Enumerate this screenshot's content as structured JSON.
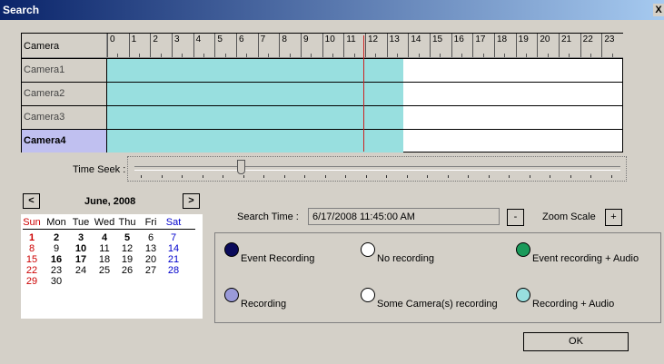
{
  "window": {
    "title": "Search",
    "close": "X"
  },
  "grid": {
    "header": "Camera",
    "hours": [
      "0",
      "1",
      "2",
      "3",
      "4",
      "5",
      "6",
      "7",
      "8",
      "9",
      "10",
      "11",
      "12",
      "13",
      "14",
      "15",
      "16",
      "17",
      "18",
      "19",
      "20",
      "21",
      "22",
      "23"
    ],
    "rows": [
      {
        "name": "Camera1",
        "selected": false
      },
      {
        "name": "Camera2",
        "selected": false
      },
      {
        "name": "Camera3",
        "selected": false
      },
      {
        "name": "Camera4",
        "selected": true
      }
    ],
    "recording_color": "#98dfdf",
    "cursor_color": "#cc2222"
  },
  "seek": {
    "label": "Time Seek :"
  },
  "calendar": {
    "prev": "<",
    "next": ">",
    "month": "June, 2008",
    "weekdays": [
      "Sun",
      "Mon",
      "Tue",
      "Wed",
      "Thu",
      "Fri",
      "Sat"
    ],
    "weeks": [
      [
        "1",
        "2",
        "3",
        "4",
        "5",
        "6",
        "7"
      ],
      [
        "8",
        "9",
        "10",
        "11",
        "12",
        "13",
        "14"
      ],
      [
        "15",
        "16",
        "17",
        "18",
        "19",
        "20",
        "21"
      ],
      [
        "22",
        "23",
        "24",
        "25",
        "26",
        "27",
        "28"
      ],
      [
        "29",
        "30",
        "",
        "",
        "",
        "",
        ""
      ]
    ]
  },
  "search_time": {
    "label": "Search Time :",
    "value": "6/17/2008 11:45:00 AM"
  },
  "zoom": {
    "label": "Zoom Scale",
    "minus": "-",
    "plus": "+"
  },
  "legend": [
    {
      "label": "Event Recording",
      "color": "#0a0a5a"
    },
    {
      "label": "No recording",
      "color": "#ffffff"
    },
    {
      "label": "Event recording + Audio",
      "color": "#1a9a5a"
    },
    {
      "label": "Recording",
      "color": "#9a9ad8"
    },
    {
      "label": "Some Camera(s) recording",
      "color": "#ffffff"
    },
    {
      "label": "Recording + Audio",
      "color": "#98dfdf"
    }
  ],
  "ok": "OK"
}
